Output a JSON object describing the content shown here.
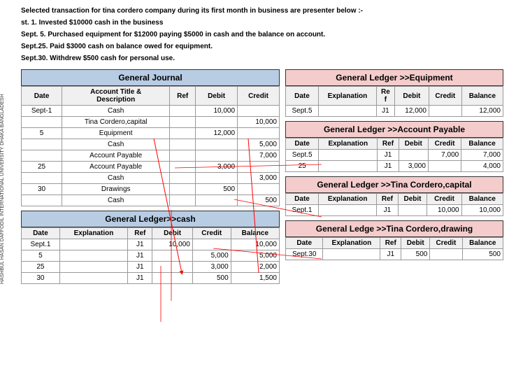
{
  "intro": {
    "line1": "Selected transaction for tina cordero company during its first month in business are presenter below :-",
    "line2": "st.  1. Invested $10000 cash  in the business",
    "line3": "Sept.  5. Purchased equipment for $12000 paying $5000 in cash and the balance on account.",
    "line4": "Sept.25. Paid $3000 cash on balance owed for equipment.",
    "line5": "Sept.30. Withdrew $500 cash for personal use."
  },
  "journal": {
    "title": "General Journal",
    "headers": [
      "Date",
      "Account Title & Description",
      "Ref",
      "Debit",
      "Credit"
    ],
    "rows": [
      {
        "date": "Sept-1",
        "account": "Cash",
        "ref": "",
        "debit": "10,000",
        "credit": ""
      },
      {
        "date": "",
        "account": "Tina Cordero,capital",
        "ref": "",
        "debit": "",
        "credit": "10,000"
      },
      {
        "date": "5",
        "account": "Equipment",
        "ref": "",
        "debit": "12,000",
        "credit": ""
      },
      {
        "date": "",
        "account": "Cash",
        "ref": "",
        "debit": "",
        "credit": "5,000"
      },
      {
        "date": "",
        "account": "Account Payable",
        "ref": "",
        "debit": "",
        "credit": "7,000"
      },
      {
        "date": "25",
        "account": "Account Payable",
        "ref": "",
        "debit": "3,000",
        "credit": ""
      },
      {
        "date": "",
        "account": "Cash",
        "ref": "",
        "debit": "",
        "credit": "3,000"
      },
      {
        "date": "30",
        "account": "Drawings",
        "ref": "",
        "debit": "500",
        "credit": ""
      },
      {
        "date": "",
        "account": "Cash",
        "ref": "",
        "debit": "",
        "credit": "500"
      }
    ]
  },
  "gl_cash": {
    "title": "General Ledger>>cash",
    "headers": [
      "Date",
      "Explanation",
      "Ref",
      "Debit",
      "Credit",
      "Balance"
    ],
    "rows": [
      {
        "date": "Sept.1",
        "explanation": "",
        "ref": "J1",
        "debit": "10,000",
        "credit": "",
        "balance": "10,000"
      },
      {
        "date": "5",
        "explanation": "",
        "ref": "J1",
        "debit": "",
        "credit": "5,000",
        "balance": "5,000"
      },
      {
        "date": "25",
        "explanation": "",
        "ref": "J1",
        "debit": "",
        "credit": "3,000",
        "balance": "2,000"
      },
      {
        "date": "30",
        "explanation": "",
        "ref": "J1",
        "debit": "",
        "credit": "500",
        "balance": "1,500"
      }
    ]
  },
  "gl_equipment": {
    "title": "General Ledger >>Equipment",
    "headers": [
      "Date",
      "Explanation",
      "Ref",
      "Debit",
      "Credit",
      "Balance"
    ],
    "rows": [
      {
        "date": "Sept.5",
        "explanation": "",
        "ref": "J1",
        "debit": "12,000",
        "credit": "",
        "balance": "12,000"
      }
    ]
  },
  "gl_ap": {
    "title": "General Ledger >>Account Payable",
    "headers": [
      "Date",
      "Explanation",
      "Ref",
      "Debit",
      "Credit",
      "Balance"
    ],
    "rows": [
      {
        "date": "Sept.5",
        "explanation": "",
        "ref": "J1",
        "debit": "",
        "credit": "7,000",
        "balance": "7,000"
      },
      {
        "date": "25",
        "explanation": "",
        "ref": "J1",
        "debit": "3,000",
        "credit": "",
        "balance": "4,000"
      }
    ]
  },
  "gl_capital": {
    "title": "General Ledger >>Tina Cordero,capital",
    "headers": [
      "Date",
      "Explanation",
      "Ref",
      "Debit",
      "Credit",
      "Balance"
    ],
    "rows": [
      {
        "date": "Sept.1",
        "explanation": "",
        "ref": "J1",
        "debit": "",
        "credit": "10,000",
        "balance": "10,000"
      }
    ]
  },
  "gl_drawing": {
    "title": "General Ledge >>Tina Cordero,drawing",
    "headers": [
      "Date",
      "Explanation",
      "Ref",
      "Debit",
      "Credit",
      "Balance"
    ],
    "rows": [
      {
        "date": "Sept.30",
        "explanation": "",
        "ref": "J1",
        "debit": "500",
        "credit": "",
        "balance": "500"
      }
    ]
  },
  "vertical_text": "HASHBUL HASAN\nDAFFODIL INTERNATIONAL UNIVERSITY\nDHAKA BANGLADESH"
}
